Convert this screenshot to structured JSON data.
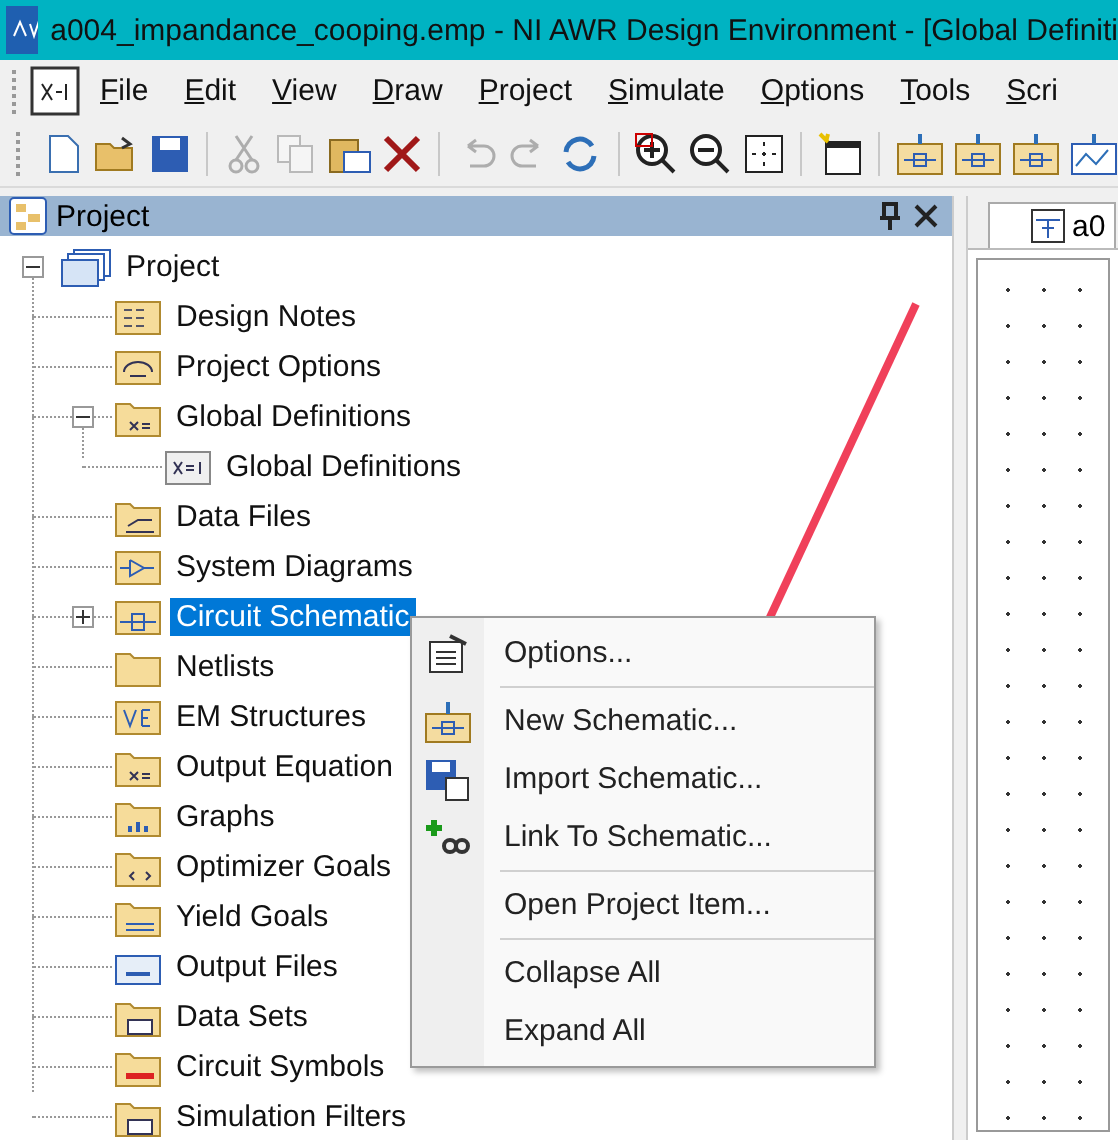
{
  "window": {
    "title": "a004_impandance_cooping.emp - NI AWR Design Environment - [Global Definiti"
  },
  "menu_bar": [
    "File",
    "Edit",
    "View",
    "Draw",
    "Project",
    "Simulate",
    "Options",
    "Tools",
    "Scri"
  ],
  "toolbar": [
    {
      "kind": "new",
      "disabled": false
    },
    {
      "kind": "open",
      "disabled": false
    },
    {
      "kind": "save",
      "disabled": false
    },
    {
      "kind": "sep"
    },
    {
      "kind": "cut",
      "disabled": true
    },
    {
      "kind": "copy",
      "disabled": true
    },
    {
      "kind": "paste",
      "disabled": false
    },
    {
      "kind": "delete",
      "disabled": false
    },
    {
      "kind": "sep"
    },
    {
      "kind": "undo",
      "disabled": true
    },
    {
      "kind": "redo",
      "disabled": true
    },
    {
      "kind": "refresh",
      "disabled": false
    },
    {
      "kind": "sep"
    },
    {
      "kind": "zoom-in",
      "disabled": false
    },
    {
      "kind": "zoom-out",
      "disabled": false
    },
    {
      "kind": "fit",
      "disabled": false
    },
    {
      "kind": "sep"
    },
    {
      "kind": "window",
      "disabled": false
    },
    {
      "kind": "sep"
    },
    {
      "kind": "schematic",
      "disabled": false
    },
    {
      "kind": "schematic",
      "disabled": false
    },
    {
      "kind": "schematic",
      "disabled": false
    },
    {
      "kind": "graph",
      "disabled": false
    }
  ],
  "project_panel": {
    "title": "Project",
    "tree": [
      {
        "label": "Project",
        "expanded": true,
        "selected": false,
        "children": [
          {
            "label": "Design Notes",
            "selected": false
          },
          {
            "label": "Project Options",
            "selected": false
          },
          {
            "label": "Global Definitions",
            "expanded": true,
            "selected": false,
            "children": [
              {
                "label": "Global Definitions",
                "selected": false
              }
            ]
          },
          {
            "label": "Data Files",
            "selected": false
          },
          {
            "label": "System Diagrams",
            "selected": false
          },
          {
            "label": "Circuit Schematic",
            "expanded": false,
            "selected": true
          },
          {
            "label": "Netlists",
            "selected": false
          },
          {
            "label": "EM Structures",
            "selected": false
          },
          {
            "label": "Output Equation",
            "selected": false
          },
          {
            "label": "Graphs",
            "selected": false
          },
          {
            "label": "Optimizer Goals",
            "selected": false
          },
          {
            "label": "Yield Goals",
            "selected": false
          },
          {
            "label": "Output Files",
            "selected": false
          },
          {
            "label": "Data Sets",
            "selected": false
          },
          {
            "label": "Circuit Symbols",
            "selected": false
          },
          {
            "label": "Simulation Filters",
            "selected": false
          }
        ]
      }
    ]
  },
  "document_tab": {
    "label": "a0"
  },
  "context_menu": [
    {
      "kind": "item",
      "label": "Options..."
    },
    {
      "kind": "sep"
    },
    {
      "kind": "item",
      "label": "New Schematic..."
    },
    {
      "kind": "item",
      "label": "Import Schematic..."
    },
    {
      "kind": "item",
      "label": "Link To Schematic..."
    },
    {
      "kind": "sep"
    },
    {
      "kind": "item",
      "label": "Open Project Item..."
    },
    {
      "kind": "sep"
    },
    {
      "kind": "item",
      "label": "Collapse All"
    },
    {
      "kind": "item",
      "label": "Expand All"
    }
  ]
}
